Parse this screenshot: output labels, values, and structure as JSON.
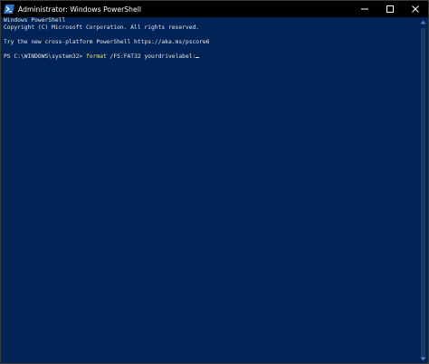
{
  "window": {
    "title": "Administrator: Windows PowerShell",
    "icon": "powershell-icon",
    "controls": [
      "minimize-icon",
      "maximize-icon",
      "close-icon"
    ]
  },
  "terminal": {
    "lines": [
      "Windows PowerShell",
      "Copyright (C) Microsoft Corporation. All rights reserved.",
      "",
      "Try the new cross-platform PowerShell https://aka.ms/pscore6",
      ""
    ],
    "prompt": "PS C:\\WINDOWS\\system32> ",
    "command_name": "format",
    "command_args": " /FS:FAT32 yourdrivelabel:"
  },
  "colors": {
    "background": "#012456",
    "text": "#e6e6e6",
    "command": "#f6f05c",
    "titlebar": "#000000"
  }
}
